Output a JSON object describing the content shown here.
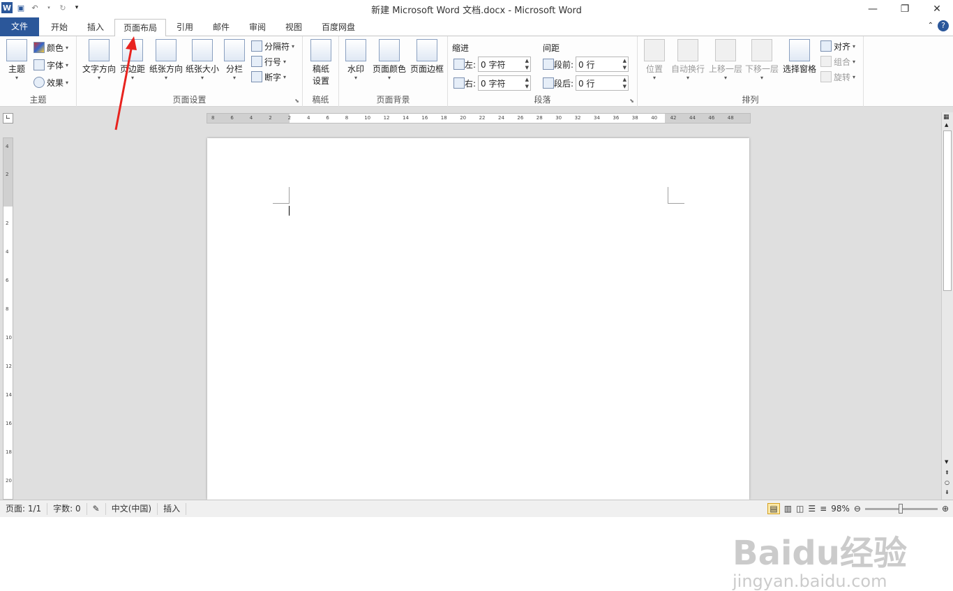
{
  "window": {
    "title": "新建 Microsoft Word 文档.docx - Microsoft Word"
  },
  "qat": {
    "word_icon": "W"
  },
  "tabs": [
    "文件",
    "开始",
    "插入",
    "页面布局",
    "引用",
    "邮件",
    "审阅",
    "视图",
    "百度网盘"
  ],
  "active_tab": "页面布局",
  "ribbon": {
    "theme": {
      "label": "主题",
      "themes": "主题",
      "colors": "颜色",
      "fonts": "字体",
      "effects": "效果"
    },
    "page_setup": {
      "label": "页面设置",
      "text_dir": "文字方向",
      "margins": "页边距",
      "orientation": "纸张方向",
      "size": "纸张大小",
      "columns": "分栏",
      "breaks": "分隔符",
      "line_numbers": "行号",
      "hyphenation": "断字"
    },
    "draft": {
      "label": "稿纸",
      "setup": "稿纸设置"
    },
    "background": {
      "label": "页面背景",
      "watermark": "水印",
      "page_color": "页面颜色",
      "page_borders": "页面边框"
    },
    "paragraph": {
      "label": "段落",
      "indent": "缩进",
      "spacing": "间距",
      "left": "左:",
      "right": "右:",
      "before": "段前:",
      "after": "段后:",
      "left_val": "0 字符",
      "right_val": "0 字符",
      "before_val": "0 行",
      "after_val": "0 行"
    },
    "arrange": {
      "label": "排列",
      "position": "位置",
      "wrap": "自动换行",
      "forward": "上移一层",
      "backward": "下移一层",
      "pane": "选择窗格",
      "align": "对齐",
      "group": "组合",
      "rotate": "旋转"
    }
  },
  "ruler": {
    "h": [
      "8",
      "6",
      "4",
      "2",
      "2",
      "4",
      "6",
      "8",
      "10",
      "12",
      "14",
      "16",
      "18",
      "20",
      "22",
      "24",
      "26",
      "28",
      "30",
      "32",
      "34",
      "36",
      "38",
      "40",
      "42",
      "44",
      "46",
      "48"
    ],
    "v": [
      "4",
      "2",
      "2",
      "4",
      "6",
      "8",
      "10",
      "12",
      "14",
      "16",
      "18",
      "20"
    ]
  },
  "status": {
    "page": "页面: 1/1",
    "words": "字数: 0",
    "lang": "中文(中国)",
    "mode": "插入",
    "zoom": "98%",
    "zoom_fraction": 0.49
  },
  "watermark": {
    "logo": "Baidu经验",
    "url": "jingyan.baidu.com"
  }
}
